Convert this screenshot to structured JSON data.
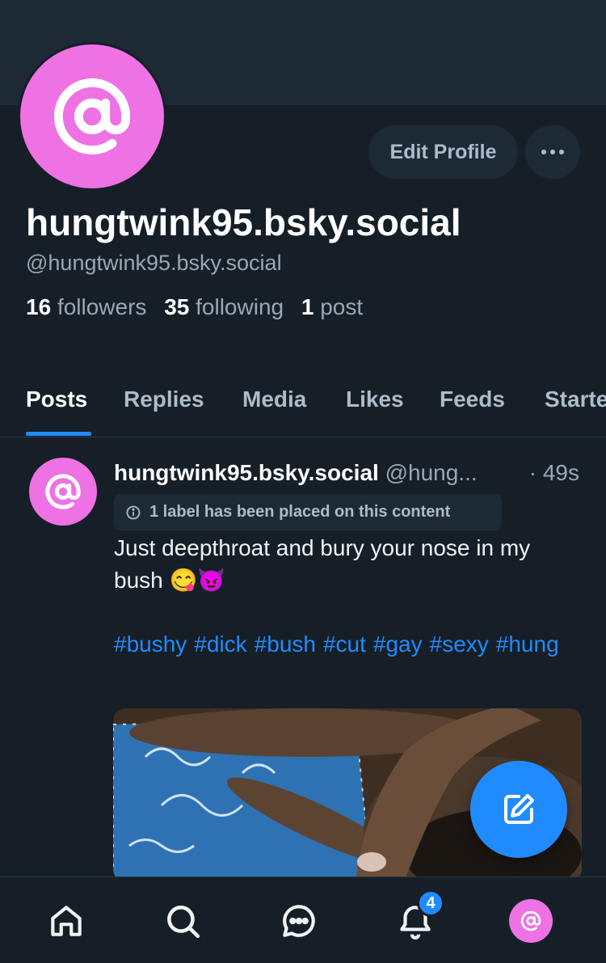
{
  "profile": {
    "display_name": "hungtwink95.bsky.social",
    "handle": "@hungtwink95.bsky.social",
    "followers_count": "16",
    "followers_label": "followers",
    "following_count": "35",
    "following_label": "following",
    "posts_count": "1",
    "posts_label": "post",
    "edit_button": "Edit Profile"
  },
  "tabs": [
    {
      "label": "Posts",
      "active": true
    },
    {
      "label": "Replies"
    },
    {
      "label": "Media"
    },
    {
      "label": "Likes"
    },
    {
      "label": "Feeds"
    },
    {
      "label": "Starter Packs"
    }
  ],
  "post": {
    "author_name": "hungtwink95.bsky.social",
    "author_handle": "@hung...",
    "separator": "·",
    "time": "49s",
    "label_notice": "1 label has been placed on this content",
    "text": "Just deepthroat and bury your nose in my bush 😋😈",
    "tags": [
      "#bushy",
      "#dick",
      "#bush",
      "#cut",
      "#gay",
      "#sexy",
      "#hung"
    ]
  },
  "nav": {
    "items": [
      "home-icon",
      "search-icon",
      "chat-icon",
      "notifications-icon",
      "profile-avatar"
    ],
    "notification_badge": "4"
  },
  "colors": {
    "background": "#161e27",
    "accent": "#208bfe",
    "avatar": "#ee72e4"
  }
}
